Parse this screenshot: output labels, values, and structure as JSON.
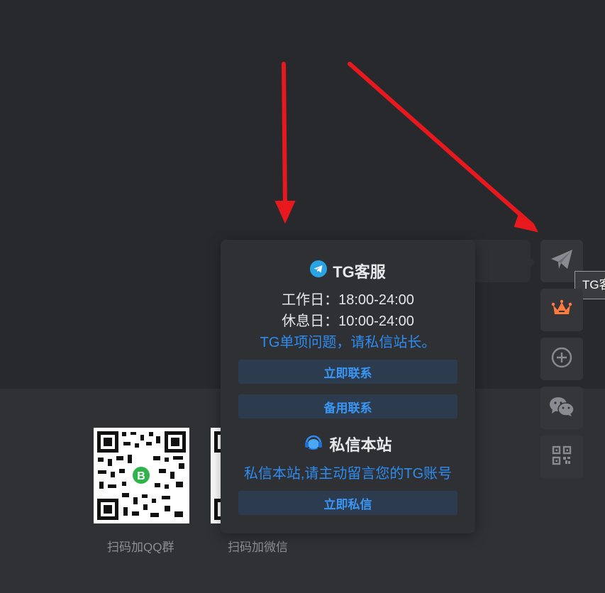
{
  "popup": {
    "tg_title": "TG客服",
    "workday": "工作日：18:00-24:00",
    "restday": "休息日：10:00-24:00",
    "tg_note": "TG单项问题，请私信站长。",
    "contact_now": "立即联系",
    "backup_contact": "备用联系",
    "pm_title": "私信本站",
    "pm_note": "私信本站,请主动留言您的TG账号",
    "pm_now": "立即私信"
  },
  "tooltip": "TG客服",
  "footer": {
    "qq_caption": "扫码加QQ群",
    "wechat_caption": "扫码加微信"
  },
  "colors": {
    "accent_blue": "#2d8cf0",
    "arrow_red": "#e8191e",
    "crown_orange": "#ff7a3d",
    "telegram_blue": "#2aa3e5"
  },
  "icons": [
    "telegram-icon",
    "headset-icon",
    "send-icon",
    "crown-icon",
    "plus-circle-icon",
    "wechat-icon",
    "qrcode-icon"
  ]
}
